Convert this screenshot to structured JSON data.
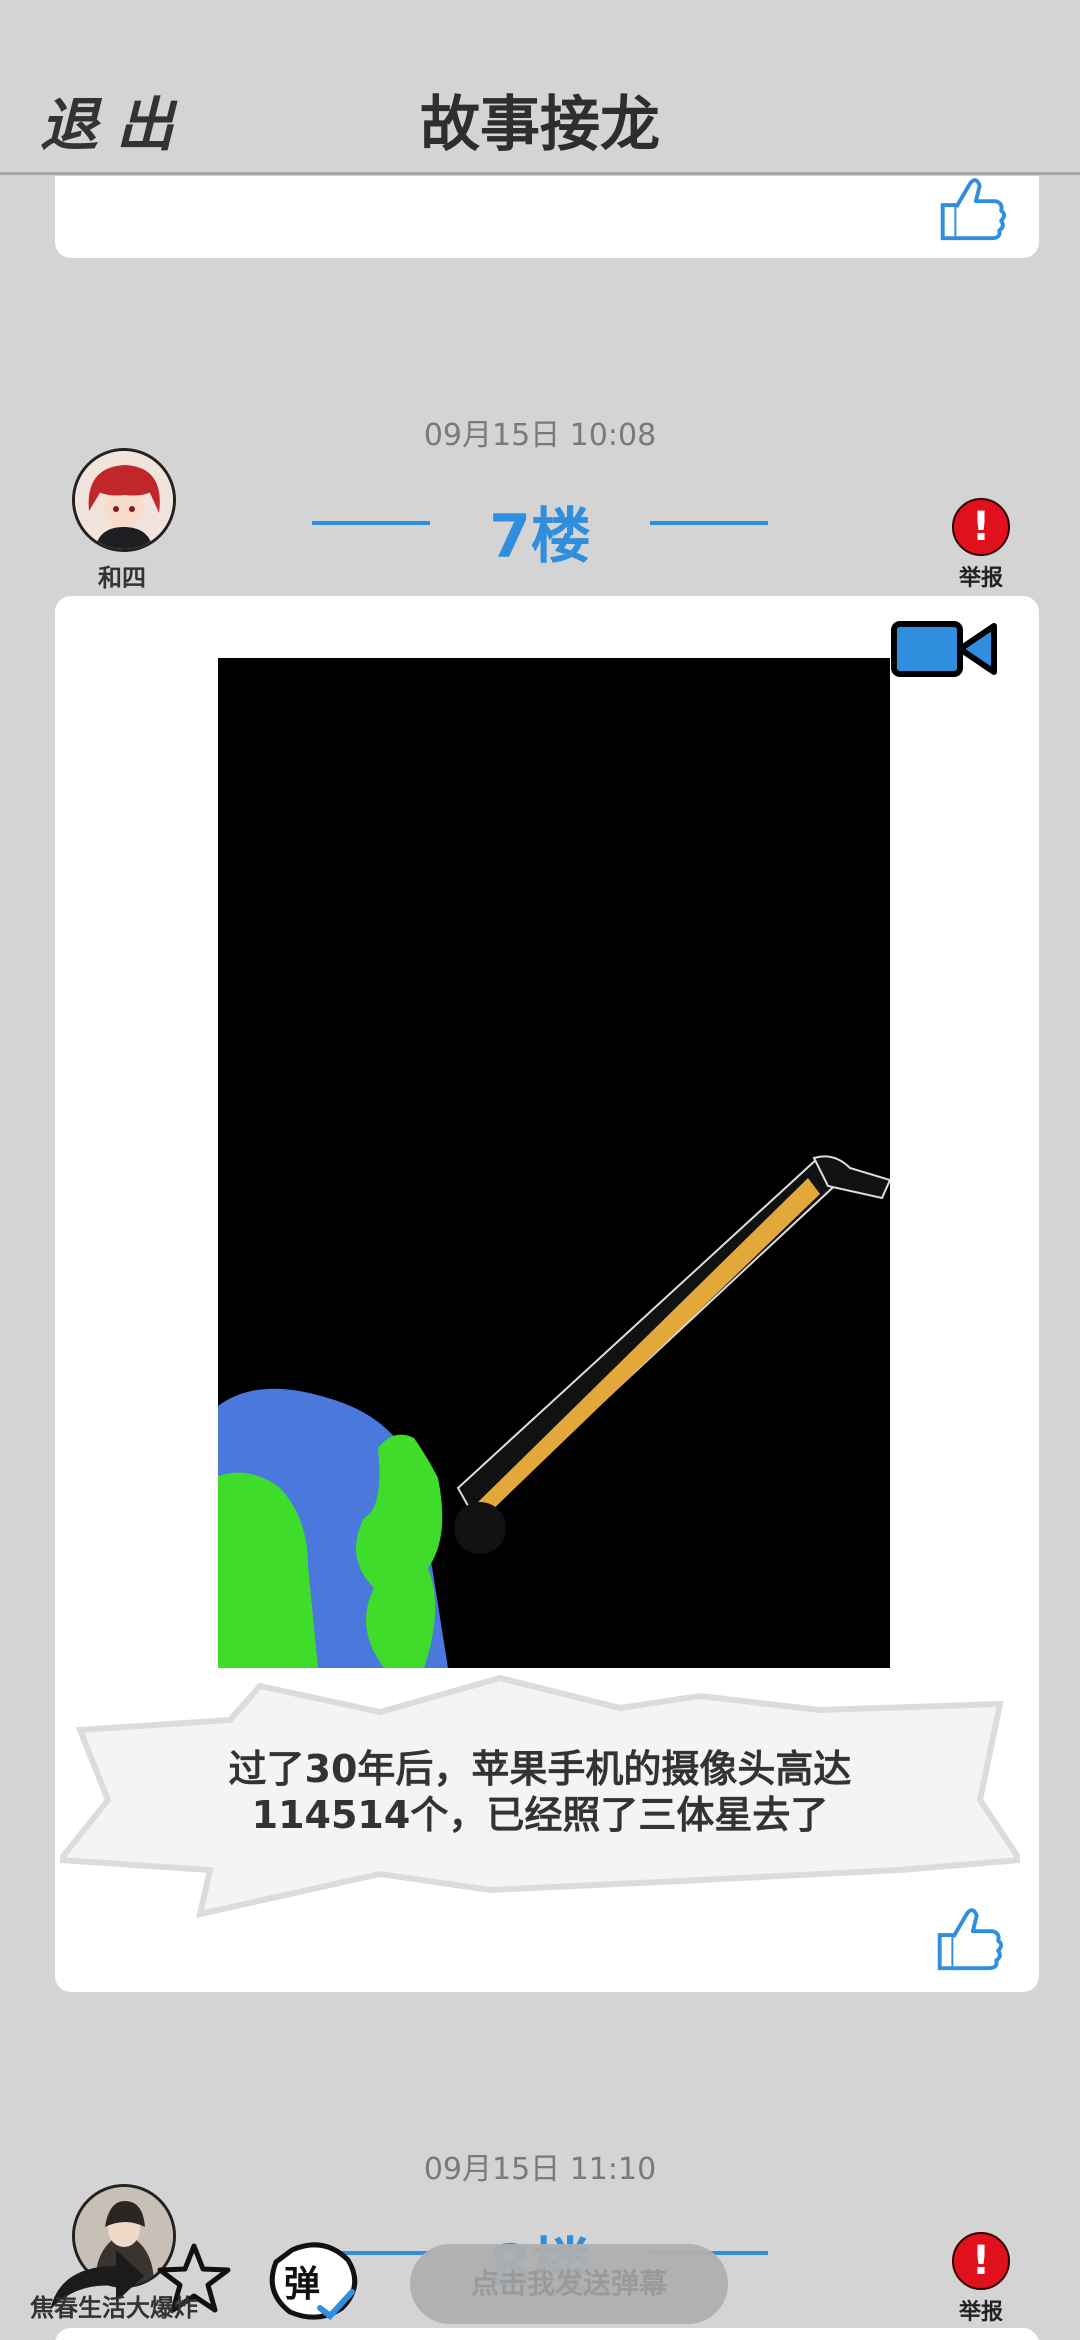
{
  "header": {
    "exit_label": "退出",
    "title": "故事接龙"
  },
  "posts": [
    {
      "timestamp": "09月15日  10:08",
      "floor": "7楼",
      "author": "和四",
      "report_label": "举报",
      "caption": "过了30年后，苹果手机的摄像头高达114514个，已经照了三体星去了"
    },
    {
      "timestamp": "09月15日  11:10",
      "floor": "8楼",
      "report_label": "举报"
    }
  ],
  "bottom": {
    "user_name": "焦春生活大爆炸",
    "danmaku_placeholder": "点击我发送弹幕"
  },
  "colors": {
    "accent": "#2f8fde",
    "report": "#e0101c",
    "background": "#d4d4d4"
  }
}
